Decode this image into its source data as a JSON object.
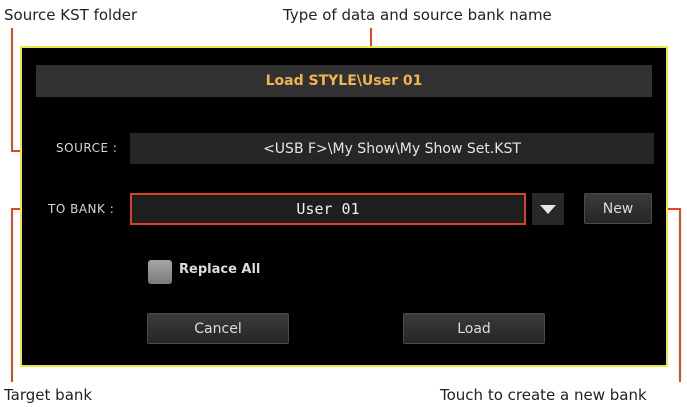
{
  "annotations": {
    "source_folder": "Source KST folder",
    "type_and_bank": "Type of data and source bank name",
    "target_bank": "Target bank",
    "new_bank": "Touch to create a new bank"
  },
  "dialog": {
    "title": "Load STYLE\\User 01",
    "source_label": "SOURCE :",
    "source_value": "<USB F>\\My Show\\My Show Set.KST",
    "to_bank_label": "TO BANK :",
    "to_bank_value": "User 01",
    "new_button": "New",
    "replace_all_label": "Replace All",
    "replace_all_checked": false,
    "cancel_button": "Cancel",
    "load_button": "Load"
  },
  "colors": {
    "accent": "#e8471d",
    "title_text": "#f2b450",
    "dialog_border": "#e8e84a"
  },
  "icons": {
    "dropdown": "chevron-down-icon"
  }
}
